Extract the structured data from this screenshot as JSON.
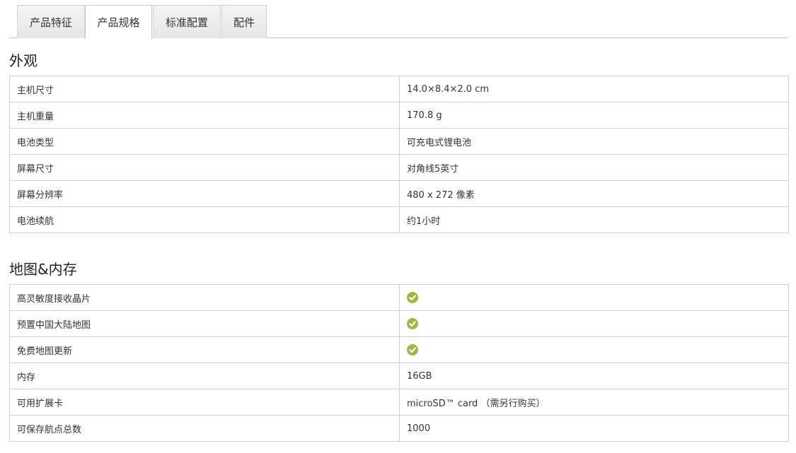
{
  "tabs": [
    {
      "label": "产品特征"
    },
    {
      "label": "产品规格"
    },
    {
      "label": "标准配置"
    },
    {
      "label": "配件"
    }
  ],
  "active_tab": "产品规格",
  "sections": [
    {
      "title": "外观",
      "rows": [
        {
          "label": "主机尺寸",
          "value": "14.0×8.4×2.0 cm"
        },
        {
          "label": "主机重量",
          "value": "170.8 g"
        },
        {
          "label": "电池类型",
          "value": "可充电式锂电池"
        },
        {
          "label": "屏幕尺寸",
          "value": "对角线5英寸"
        },
        {
          "label": "屏幕分辨率",
          "value": "480 x 272 像素"
        },
        {
          "label": "电池续航",
          "value": "约1小时"
        }
      ]
    },
    {
      "title": "地图&内存",
      "rows": [
        {
          "label": "高灵敏度接收晶片",
          "value": ""
        },
        {
          "label": "预置中国大陆地图",
          "value": ""
        },
        {
          "label": "免费地图更新",
          "value": ""
        },
        {
          "label": "内存",
          "value": "16GB"
        },
        {
          "label": "可用扩展卡",
          "value": "microSD™ card （需另行购买）"
        },
        {
          "label": "可保存航点总数",
          "value": "1000"
        }
      ]
    }
  ],
  "colors": {
    "check": "#a4b43c",
    "border": "#cfcfcf"
  },
  "icons": {
    "check": "check-circle-icon"
  }
}
